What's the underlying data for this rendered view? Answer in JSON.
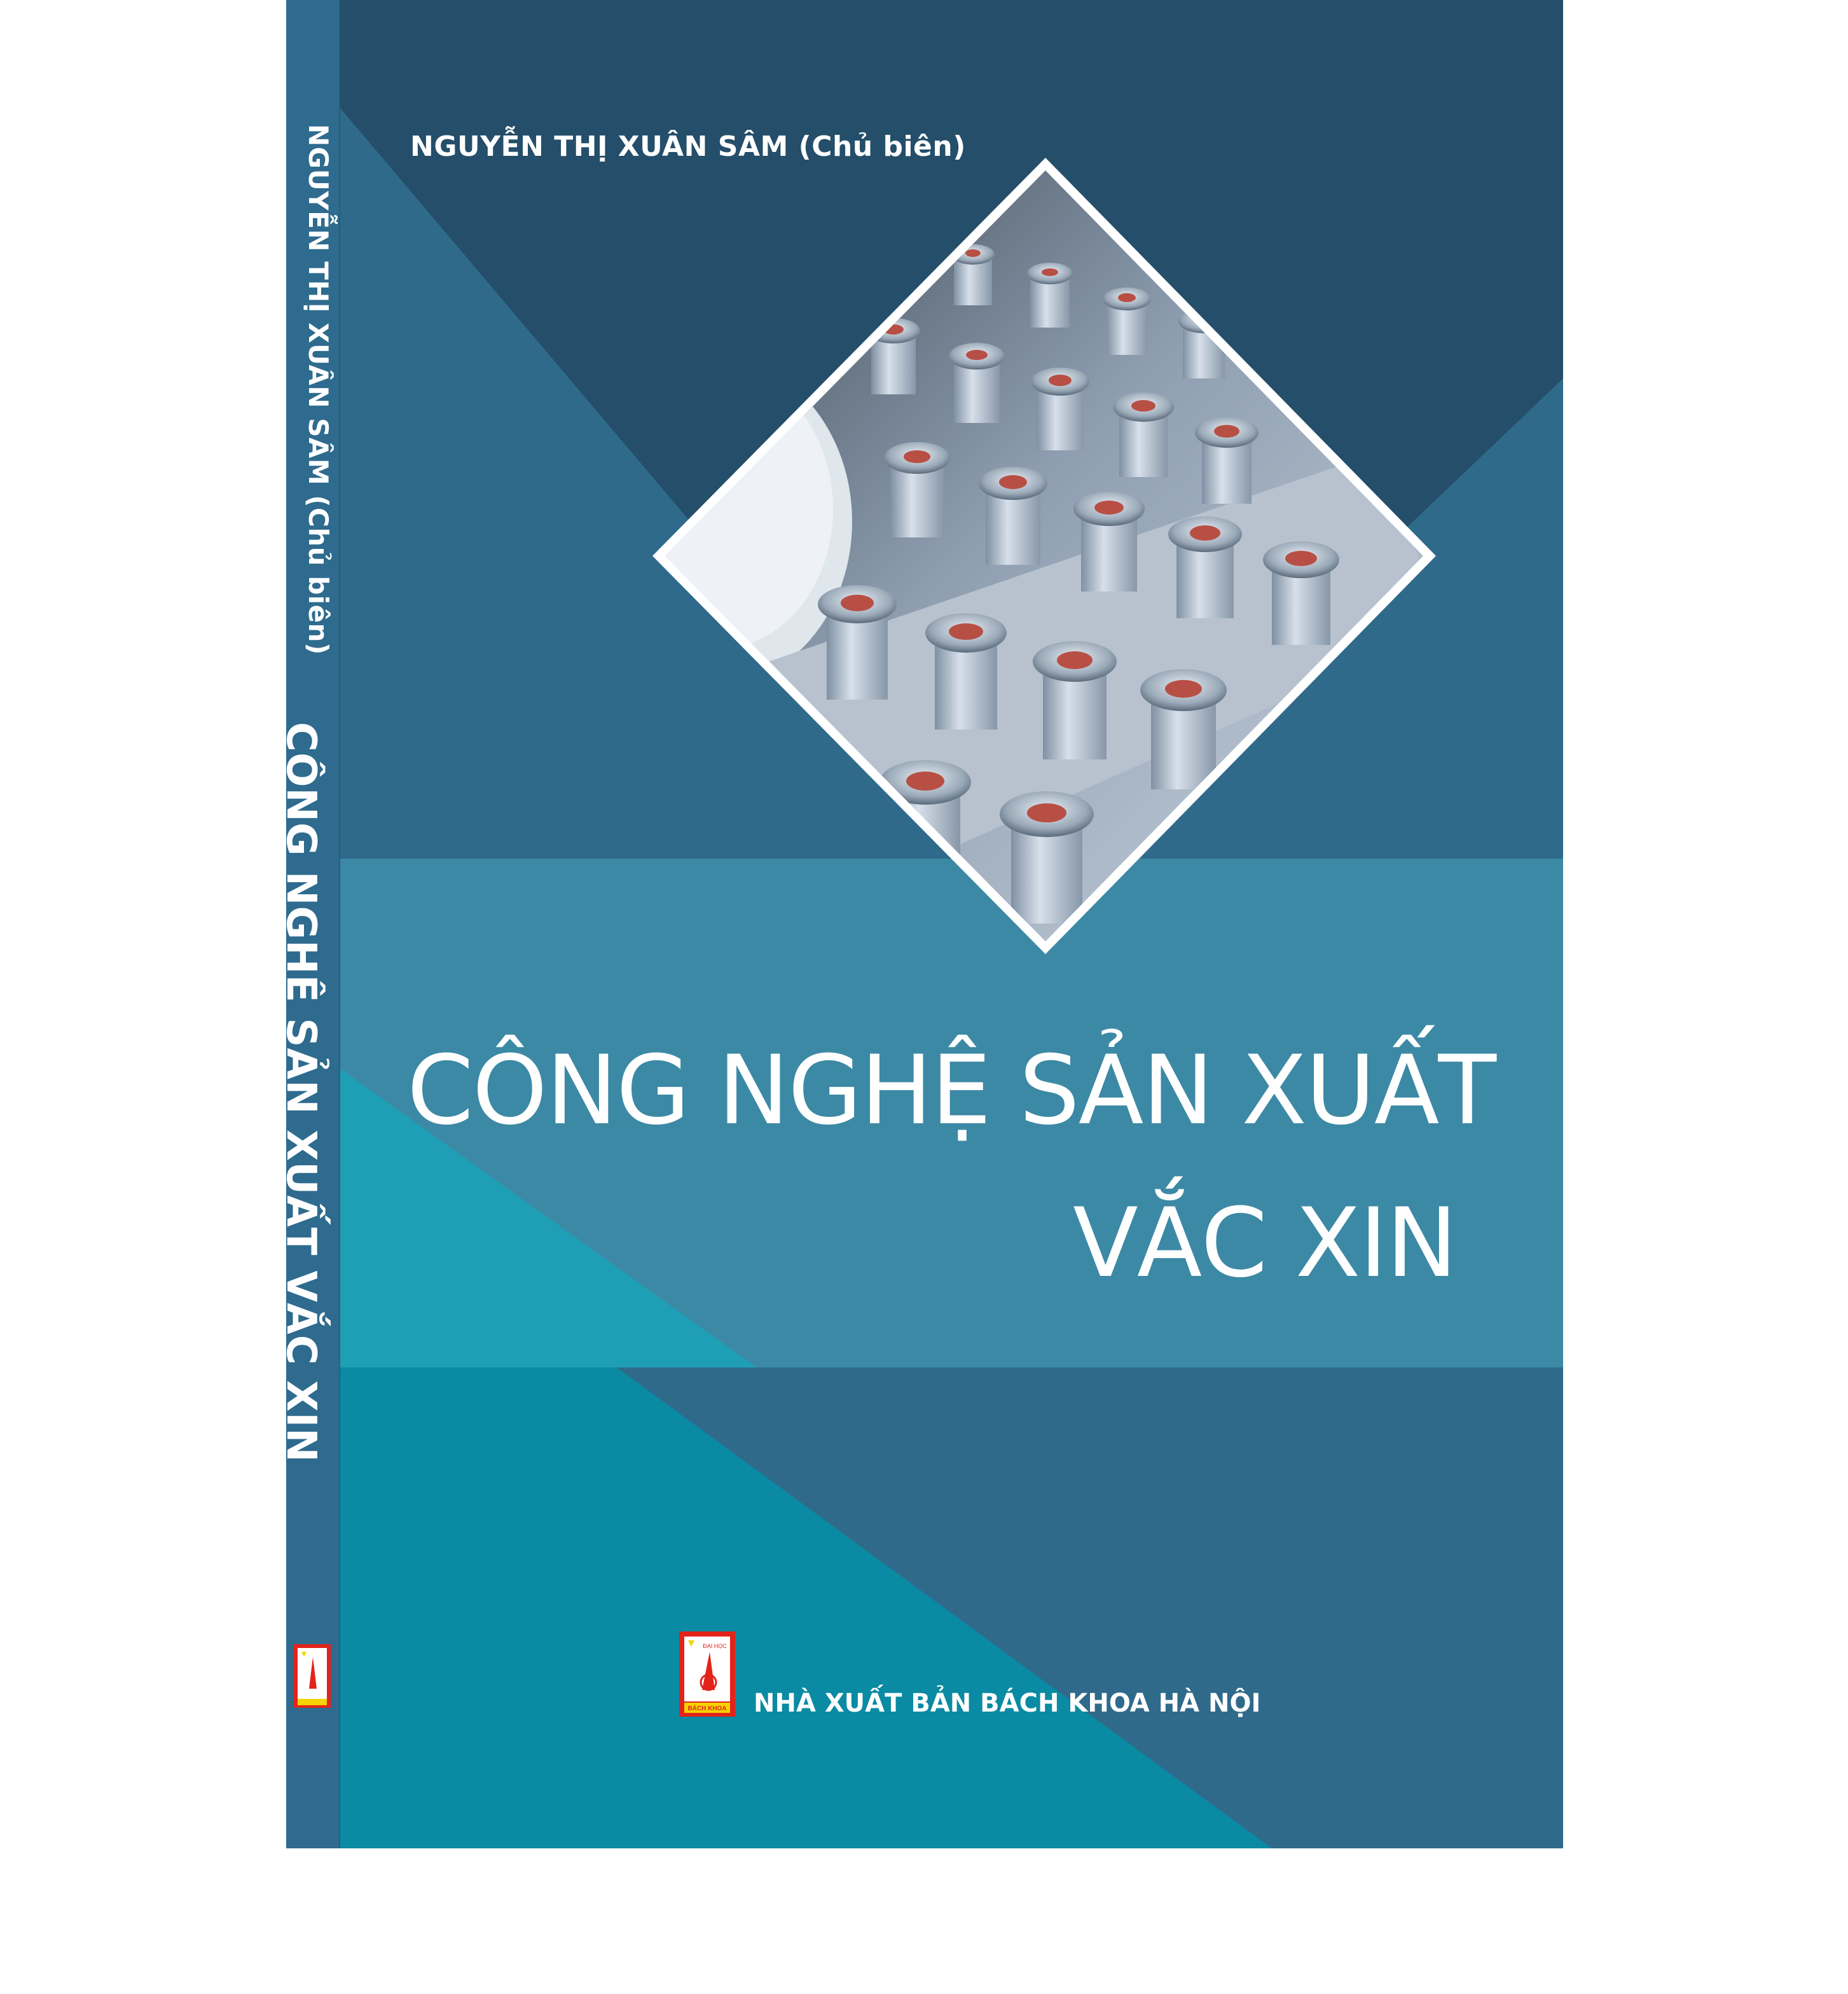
{
  "cover": {
    "author": "NGUYỄN THỊ XUÂN SÂM (Chủ biên)",
    "title_line1": "CÔNG NGHỆ SẢN XUẤT",
    "title_line2": "VẮC XIN",
    "publisher": "NHÀ XUẤT BẢN BÁCH KHOA HÀ NỘI"
  },
  "spine": {
    "author": "NGUYỄN THỊ XUÂN SÂM (Chủ biên)",
    "title": "CÔNG NGHỆ SẢN XUẤT VẮC XIN"
  },
  "logo": {
    "top_text": "ĐẠI HỌC",
    "bottom_text": "BÁCH KHOA"
  },
  "colors": {
    "dark_navy": "#244e6a",
    "steel_blue": "#2f6a8b",
    "band_blue": "#3c89a5",
    "teal": "#1f9fb5",
    "deep_teal": "#0a8aa3",
    "spine": "#2e6b8e",
    "logo_red": "#e2231a",
    "logo_yellow": "#f5d200"
  },
  "icons": {
    "cover_image": "vaccine-vials-photo",
    "logo": "bach-khoa-logo"
  }
}
